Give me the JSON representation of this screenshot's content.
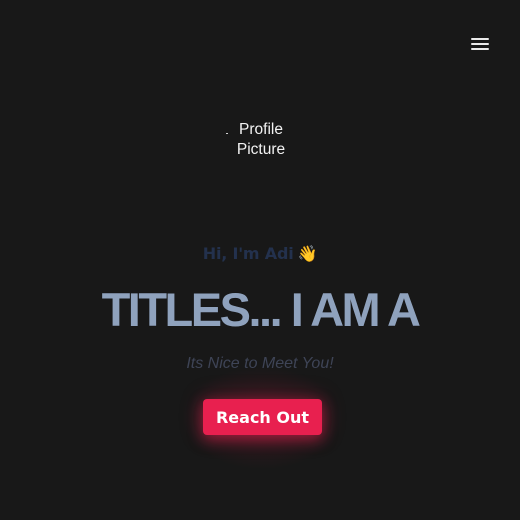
{
  "header": {
    "menu_icon": "hamburger-menu-icon"
  },
  "profile": {
    "alt_text": "Profile Picture"
  },
  "hero": {
    "greeting": "Hi, I'm Adi",
    "greeting_emoji": "👋",
    "title": "TITLES... I AM A",
    "subtitle": "Its Nice to Meet You!",
    "cta_label": "Reach Out"
  },
  "colors": {
    "background": "#181818",
    "greeting": "#23314d",
    "title": "#8fa2bd",
    "subtitle": "#3e4456",
    "accent": "#e8204f"
  }
}
